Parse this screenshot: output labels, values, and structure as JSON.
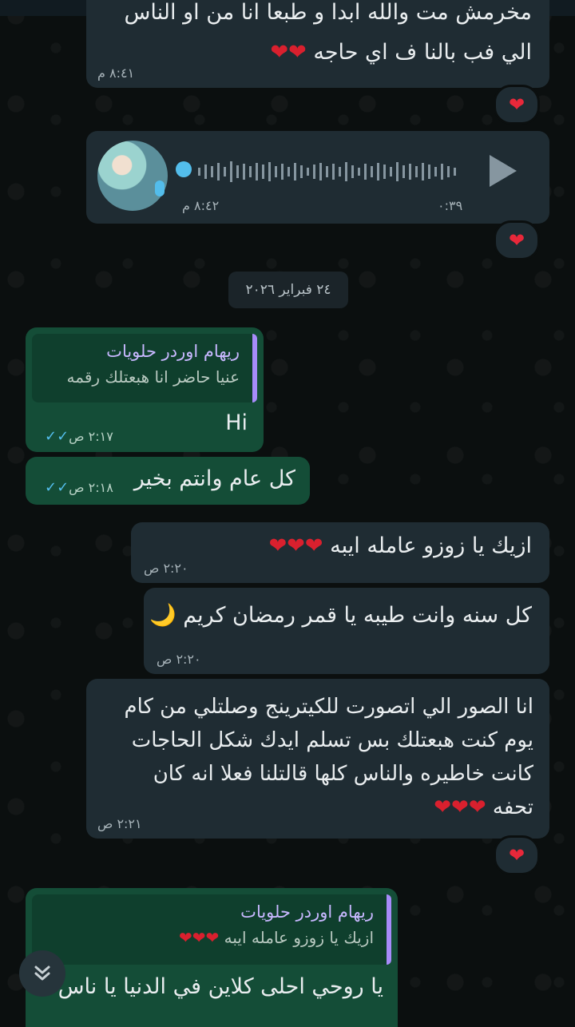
{
  "messages": {
    "m1": {
      "line1": "مخرمش مت والله ابدا و طبعا انا من او الناس",
      "line2": "الي فب بالنا ف اي حاجه",
      "hearts": "❤❤",
      "time": "٨:٤١ م",
      "reaction": "❤"
    },
    "voice": {
      "duration": "٠:٣٩",
      "time": "٨:٤٢ م",
      "reaction": "❤"
    },
    "date_chip": "٢٤ فبراير ٢٠٢٦",
    "m2": {
      "quote_name": "ريهام اوردر حلويات",
      "quote_text": "عنيا حاضر انا هبعتلك رقمه",
      "text": "Hi",
      "time": "٢:١٧ ص",
      "ticks": "✓✓"
    },
    "m3": {
      "text": "كل عام وانتم بخير",
      "time": "٢:١٨ ص",
      "ticks": "✓✓"
    },
    "m4": {
      "text": "ازيك يا زوزو عامله ايبه",
      "hearts": "❤❤❤",
      "time": "٢:٢٠ ص"
    },
    "m5": {
      "text": "كل سنه وانت طيبه يا قمر رمضان كريم",
      "moon": "🌙",
      "time": "٢:٢٠ ص"
    },
    "m6": {
      "lines": [
        "انا الصور الي اتصورت للكيترينج وصلتلي من كام",
        "يوم كنت هبعتلك بس تسلم ايدك شكل الحاجات",
        "كانت خاطيره والناس كلها قالتلنا فعلا انه كان"
      ],
      "last": "تحفه",
      "hearts": "❤❤❤",
      "time": "٢:٢١ ص",
      "reaction": "❤"
    },
    "m7": {
      "quote_name": "ريهام اوردر حلويات",
      "quote_text": "ازيك يا زوزو عامله ايبه",
      "quote_hearts": "❤❤❤",
      "text": "يا روحي  احلى كلاين في الدنيا يا ناس"
    }
  },
  "icons": {
    "mic": "mic-icon",
    "play": "play-icon",
    "scroll": "chevrons-down-icon",
    "check": "double-check-icon",
    "heart": "heart-icon"
  },
  "colors": {
    "incoming": "#1f2c33",
    "outgoing": "#144d37",
    "tick": "#53bdeb",
    "heart": "#e8283a",
    "quote_bar": "#a78bfa"
  }
}
